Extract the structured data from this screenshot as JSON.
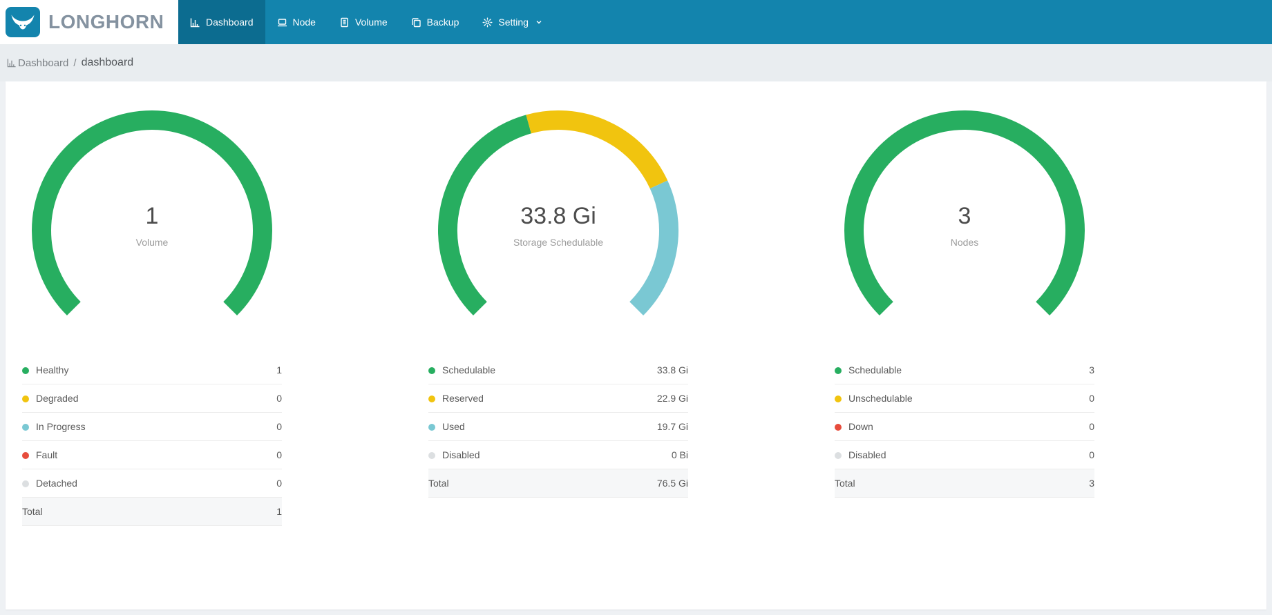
{
  "app": {
    "brand": "LONGHORN"
  },
  "nav": {
    "items": [
      {
        "label": "Dashboard",
        "icon": "dashboard-icon",
        "active": true
      },
      {
        "label": "Node",
        "icon": "node-icon",
        "active": false
      },
      {
        "label": "Volume",
        "icon": "volume-icon",
        "active": false
      },
      {
        "label": "Backup",
        "icon": "backup-icon",
        "active": false
      },
      {
        "label": "Setting",
        "icon": "setting-icon",
        "active": false,
        "has_dropdown": true
      }
    ]
  },
  "breadcrumb": {
    "section": "Dashboard",
    "separator": "/",
    "page": "dashboard"
  },
  "colors": {
    "header": "#1384ad",
    "header_active": "#0c6c90",
    "green": "#27ae60",
    "yellow": "#f1c40f",
    "teal": "#7ac8d3",
    "red": "#e74c3c",
    "gray": "#dcdfe1"
  },
  "chart_data": [
    {
      "type": "donut",
      "title": "Volume",
      "gauge": {
        "start_angle": 225,
        "sweep": 270
      },
      "center_value": "1",
      "center_label": "Volume",
      "legend_position": "bottom-table",
      "segments": [
        {
          "label": "Healthy",
          "value": 1,
          "display": "1",
          "color": "#27ae60"
        },
        {
          "label": "Degraded",
          "value": 0,
          "display": "0",
          "color": "#f1c40f"
        },
        {
          "label": "In Progress",
          "value": 0,
          "display": "0",
          "color": "#7ac8d3"
        },
        {
          "label": "Fault",
          "value": 0,
          "display": "0",
          "color": "#e74c3c"
        },
        {
          "label": "Detached",
          "value": 0,
          "display": "0",
          "color": "#dcdfe1"
        }
      ],
      "total": {
        "label": "Total",
        "display": "1"
      }
    },
    {
      "type": "donut",
      "title": "Storage Schedulable",
      "gauge": {
        "start_angle": 225,
        "sweep": 270
      },
      "center_value": "33.8 Gi",
      "center_label": "Storage Schedulable",
      "legend_position": "bottom-table",
      "segments": [
        {
          "label": "Schedulable",
          "value": 33.8,
          "display": "33.8 Gi",
          "color": "#27ae60"
        },
        {
          "label": "Reserved",
          "value": 22.9,
          "display": "22.9 Gi",
          "color": "#f1c40f"
        },
        {
          "label": "Used",
          "value": 19.7,
          "display": "19.7 Gi",
          "color": "#7ac8d3"
        },
        {
          "label": "Disabled",
          "value": 0,
          "display": "0 Bi",
          "color": "#dcdfe1"
        }
      ],
      "total": {
        "label": "Total",
        "display": "76.5 Gi"
      }
    },
    {
      "type": "donut",
      "title": "Nodes",
      "gauge": {
        "start_angle": 225,
        "sweep": 270
      },
      "center_value": "3",
      "center_label": "Nodes",
      "legend_position": "bottom-table",
      "segments": [
        {
          "label": "Schedulable",
          "value": 3,
          "display": "3",
          "color": "#27ae60"
        },
        {
          "label": "Unschedulable",
          "value": 0,
          "display": "0",
          "color": "#f1c40f"
        },
        {
          "label": "Down",
          "value": 0,
          "display": "0",
          "color": "#e74c3c"
        },
        {
          "label": "Disabled",
          "value": 0,
          "display": "0",
          "color": "#dcdfe1"
        }
      ],
      "total": {
        "label": "Total",
        "display": "3"
      }
    }
  ]
}
